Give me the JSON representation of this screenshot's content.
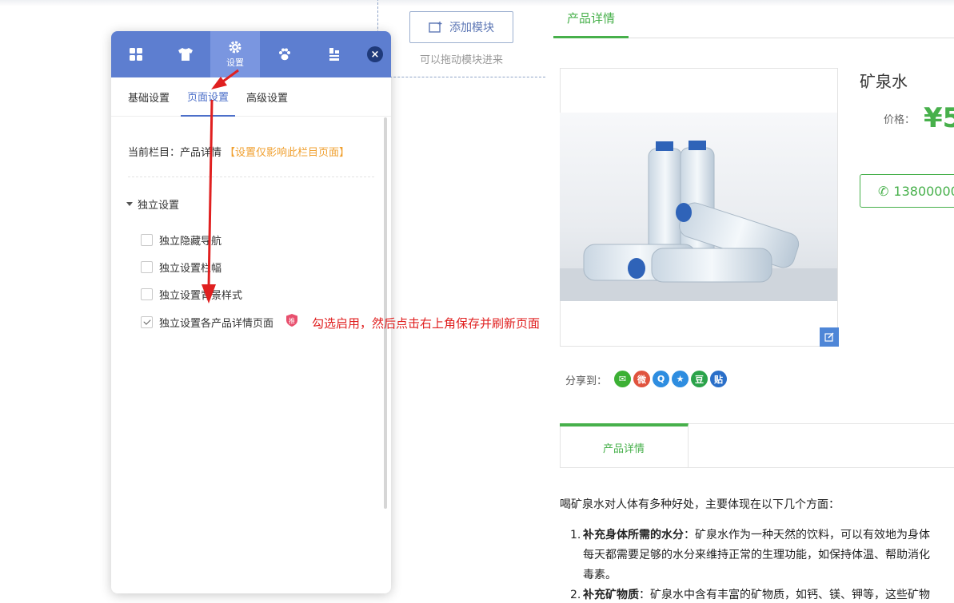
{
  "add_module": {
    "button_label": "添加模块",
    "hint": "可以拖动模块进来"
  },
  "product_page": {
    "top_tab": "产品详情",
    "title": "矿泉水",
    "price_label": "价格：",
    "price_value": "¥5",
    "phone": "13800000",
    "share_label": "分享到：",
    "share_icons": [
      {
        "name": "wechat-icon",
        "glyph": "✉",
        "color": "#3cb034"
      },
      {
        "name": "weibo-icon",
        "glyph": "微",
        "color": "#e0533e"
      },
      {
        "name": "qq-icon",
        "glyph": "Q",
        "color": "#2e8de0"
      },
      {
        "name": "qzone-icon",
        "glyph": "★",
        "color": "#2e8de0"
      },
      {
        "name": "douban-icon",
        "glyph": "豆",
        "color": "#2ba34a"
      },
      {
        "name": "tieba-icon",
        "glyph": "贴",
        "color": "#2a6fc9"
      }
    ],
    "detail_tab": "产品详情",
    "desc_intro": "喝矿泉水对人体有多种好处，主要体现在以下几个方面：",
    "items": [
      {
        "num": "1.",
        "bold": "补充身体所需的水分",
        "text": "：矿泉水作为一种天然的饮料，可以有效地为身体",
        "lines": [
          "每天都需要足够的水分来维持正常的生理功能，如保持体温、帮助消化",
          "毒素。"
        ]
      },
      {
        "num": "2.",
        "bold": "补充矿物质",
        "text": "：矿泉水中含有丰富的矿物质，如钙、镁、钾等，这些矿物",
        "lines": []
      }
    ]
  },
  "panel": {
    "head_icons": [
      {
        "name": "modules-icon",
        "label": ""
      },
      {
        "name": "theme-icon",
        "label": ""
      },
      {
        "name": "settings-icon",
        "label": "设置"
      },
      {
        "name": "paw-icon",
        "label": ""
      },
      {
        "name": "manage-icon",
        "label": ""
      }
    ],
    "close_glyph": "×",
    "tabs": [
      "基础设置",
      "页面设置",
      "高级设置"
    ],
    "active_tab": "页面设置",
    "current_column_label": "当前栏目：产品详情",
    "current_column_note": "【设置仅影响此栏目页面】",
    "section_title": "独立设置",
    "options": [
      {
        "label": "独立隐藏导航",
        "checked": false
      },
      {
        "label": "独立设置栏幅",
        "checked": false
      },
      {
        "label": "独立设置背景样式",
        "checked": false
      },
      {
        "label": "独立设置各产品详情页面",
        "checked": true
      }
    ],
    "recommend_badge": "推"
  },
  "annotation": "勾选启用，然后点击右上角保存并刷新页面",
  "colors": {
    "panel_header": "#5d7ed0",
    "accent_green": "#47b04b",
    "annotation_red": "#e02020"
  }
}
